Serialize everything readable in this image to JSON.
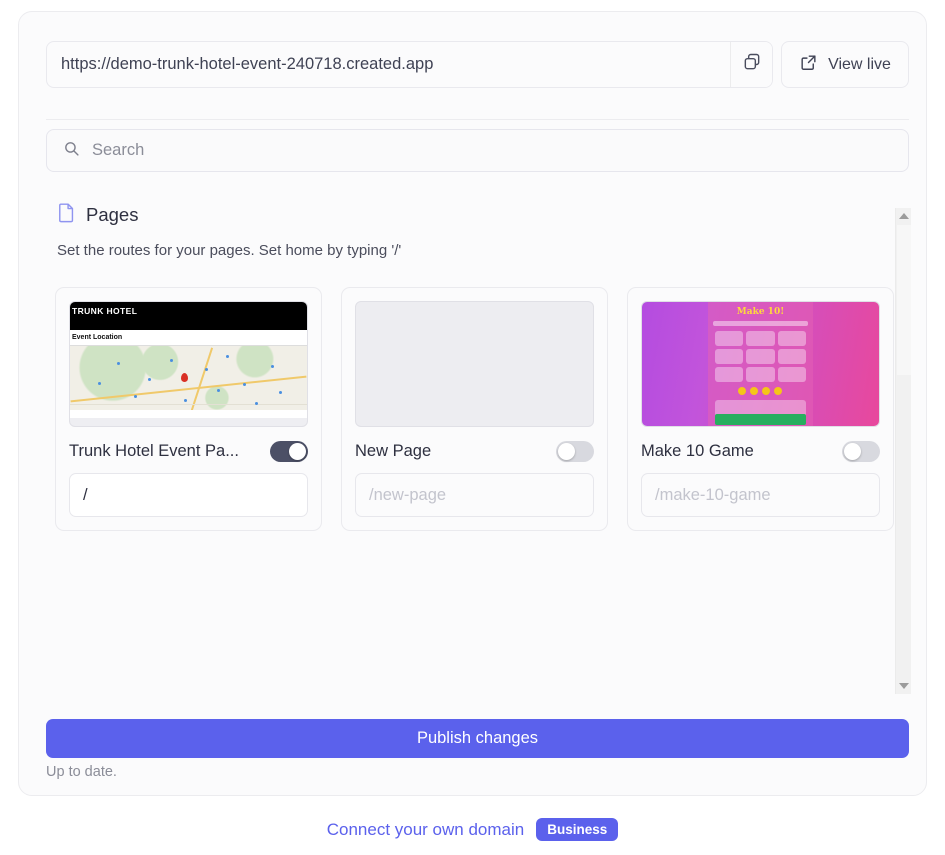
{
  "url_bar": {
    "url": "https://demo-trunk-hotel-event-240718.created.app",
    "copy_icon": "copy-icon",
    "view_live_label": "View live",
    "external_link_icon": "external-link-icon"
  },
  "search": {
    "placeholder": "Search",
    "value": "",
    "icon": "search-icon"
  },
  "pages": {
    "icon": "file-icon",
    "title": "Pages",
    "subtitle": "Set the routes for your pages. Set home by typing '/'",
    "cards": [
      {
        "label": "Trunk Hotel Event Pa...",
        "toggle_on": true,
        "route_value": "/",
        "route_placeholder": "",
        "thumbnail": "trunk-hotel-event-page-preview",
        "thumb_title": "TRUNK HOTEL",
        "thumb_section": "Event Location"
      },
      {
        "label": "New Page",
        "toggle_on": false,
        "route_value": "",
        "route_placeholder": "/new-page",
        "thumbnail": "empty-page-preview"
      },
      {
        "label": "Make 10 Game",
        "toggle_on": false,
        "route_value": "",
        "route_placeholder": "/make-10-game",
        "thumbnail": "make-10-game-preview",
        "thumb_title": "Make 10!"
      }
    ]
  },
  "publish": {
    "label": "Publish changes",
    "status": "Up to date."
  },
  "footer": {
    "link_label": "Connect your own domain",
    "badge_label": "Business"
  },
  "colors": {
    "accent": "#5b61ec",
    "toggle_on": "#4c5066",
    "toggle_off": "#d8d9df"
  }
}
